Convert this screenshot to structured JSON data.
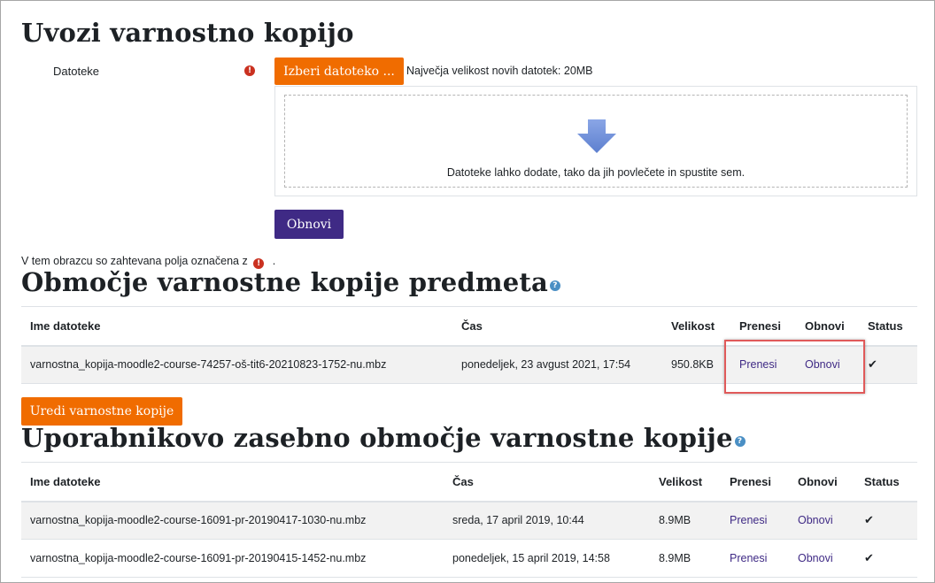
{
  "import": {
    "title": "Uvozi varnostno kopijo",
    "files_label": "Datoteke",
    "choose_button": "Izberi datoteko ...",
    "max_size": "Največja velikost novih datotek: 20MB",
    "drop_text": "Datoteke lahko dodate, tako da jih povlečete in spustite sem.",
    "restore_button": "Obnovi",
    "required_note": "V tem obrazcu so zahtevana polja označena z",
    "required_note_end": "."
  },
  "course_backup": {
    "title": "Območje varnostne kopije predmeta",
    "columns": [
      "Ime datoteke",
      "Čas",
      "Velikost",
      "Prenesi",
      "Obnovi",
      "Status"
    ],
    "rows": [
      {
        "filename": "varnostna_kopija-moodle2-course-74257-oš-tit6-20210823-1752-nu.mbz",
        "time": "ponedeljek, 23 avgust 2021, 17:54",
        "size": "950.8KB",
        "download": "Prenesi",
        "restore": "Obnovi",
        "status": "✔"
      }
    ],
    "edit_button": "Uredi varnostne kopije"
  },
  "user_backup": {
    "title": "Uporabnikovo zasebno območje varnostne kopije",
    "columns": [
      "Ime datoteke",
      "Čas",
      "Velikost",
      "Prenesi",
      "Obnovi",
      "Status"
    ],
    "rows": [
      {
        "filename": "varnostna_kopija-moodle2-course-16091-pr-20190417-1030-nu.mbz",
        "time": "sreda, 17 april 2019, 10:44",
        "size": "8.9MB",
        "download": "Prenesi",
        "restore": "Obnovi",
        "status": "✔"
      },
      {
        "filename": "varnostna_kopija-moodle2-course-16091-pr-20190415-1452-nu.mbz",
        "time": "ponedeljek, 15 april 2019, 14:58",
        "size": "8.9MB",
        "download": "Prenesi",
        "restore": "Obnovi",
        "status": "✔"
      }
    ]
  },
  "icons": {
    "required": "exclamation-circle-icon",
    "help": "question-circle-icon",
    "drop": "down-arrow-icon",
    "status_ok": "check-icon"
  },
  "colors": {
    "orange_button": "#f06c00",
    "purple_button": "#3f2a85",
    "required_red": "#ca3120",
    "link": "#3f2a85",
    "highlight_border": "#e05a5a"
  }
}
